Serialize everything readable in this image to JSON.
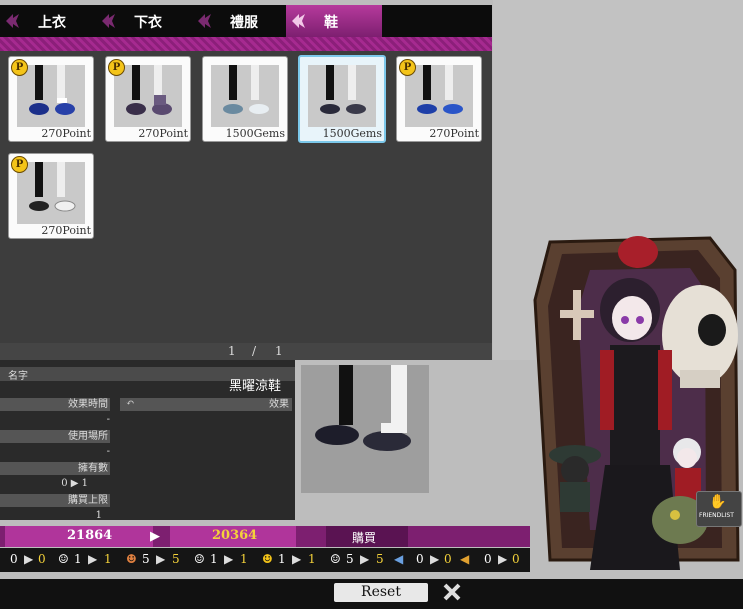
{
  "tabs": [
    {
      "label": "上衣",
      "active": false
    },
    {
      "label": "下衣",
      "active": false
    },
    {
      "label": "禮服",
      "active": false
    },
    {
      "label": "鞋",
      "active": true
    }
  ],
  "items": [
    {
      "price": "270Point",
      "badge": "P",
      "selected": false
    },
    {
      "price": "270Point",
      "badge": "P",
      "selected": false
    },
    {
      "price": "1500Gems",
      "badge": "",
      "selected": false
    },
    {
      "price": "1500Gems",
      "badge": "",
      "selected": true
    },
    {
      "price": "270Point",
      "badge": "P",
      "selected": false
    },
    {
      "price": "270Point",
      "badge": "P",
      "selected": false
    }
  ],
  "pager": {
    "current": "1",
    "sep": "/",
    "total": "1"
  },
  "detail": {
    "name_label": "名字",
    "item_name": "黑曜涼鞋",
    "effect_time_label": "效果時間",
    "effect_time_value": "-",
    "effect_label": "效果",
    "use_place_label": "使用場所",
    "use_place_value": "-",
    "owned_label": "擁有數",
    "owned_value": "0 ▶ 1",
    "limit_label": "購買上限",
    "limit_value": "1"
  },
  "currency": {
    "before": "21864",
    "after": "20364",
    "buy_label": "購買"
  },
  "stats": [
    {
      "a": "0",
      "b": "0"
    },
    {
      "a": "1",
      "b": "1"
    },
    {
      "a": "5",
      "b": "5"
    },
    {
      "a": "1",
      "b": "1"
    },
    {
      "a": "1",
      "b": "1"
    },
    {
      "a": "5",
      "b": "5"
    },
    {
      "a": "0",
      "b": "0"
    },
    {
      "a": "0",
      "b": "0"
    }
  ],
  "reset_label": "Reset",
  "friendlist_label": "FRIENDLIST",
  "colors": {
    "accent": "#b0359b",
    "accent_dark": "#7d1f70",
    "selected_border": "#7cc8ea",
    "gold": "#f4d23a"
  }
}
